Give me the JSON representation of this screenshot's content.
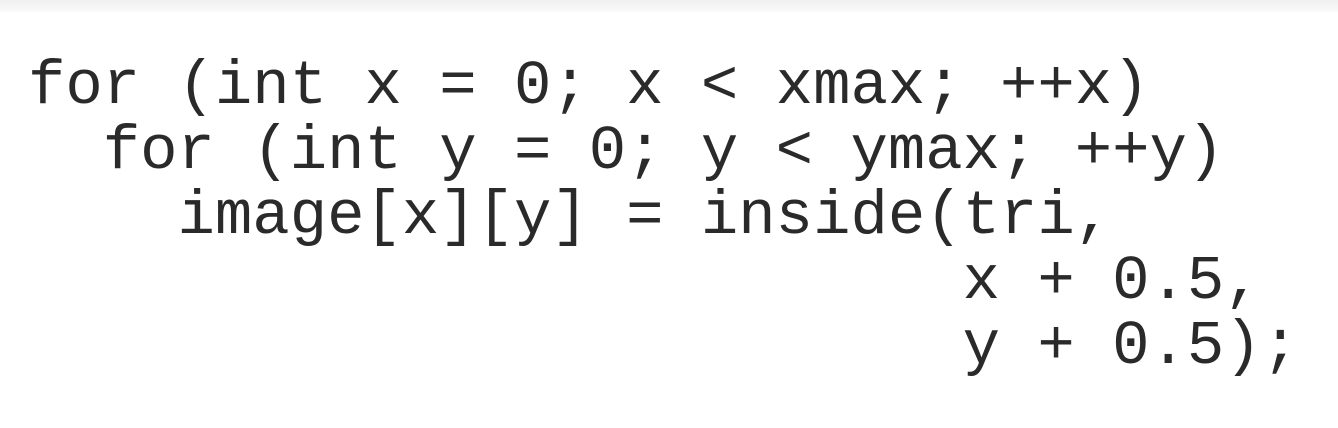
{
  "code": {
    "lines": [
      "for (int x = 0; x < xmax; ++x)",
      "  for (int y = 0; y < ymax; ++y)",
      "    image[x][y] = inside(tri,",
      "                         x + 0.5,",
      "                         y + 0.5);"
    ]
  }
}
